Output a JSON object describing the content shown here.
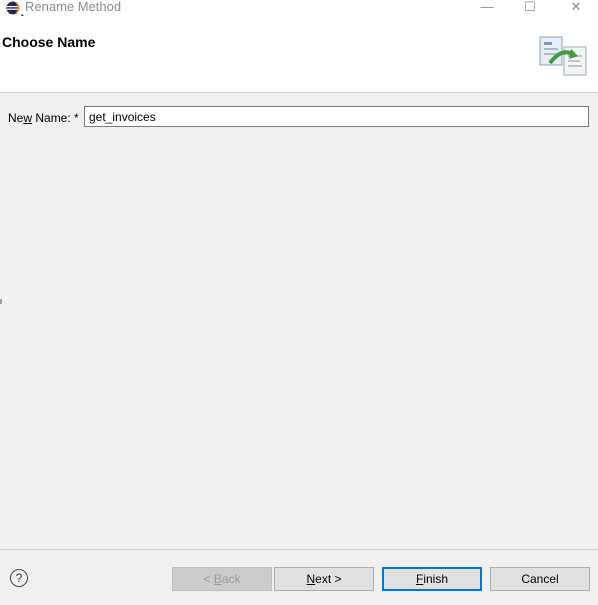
{
  "window": {
    "title": "Rename Method",
    "minimize_glyph": "—",
    "maximize_glyph": "☐",
    "close_glyph": "✕"
  },
  "banner": {
    "title": "Choose Name",
    "image_icon": "rename-refactor-icon"
  },
  "form": {
    "label_pre": "Ne",
    "label_mnemonic": "w",
    "label_post": " Name: *",
    "value": "get_invoices"
  },
  "footer": {
    "help_glyph": "?",
    "back_pre": "< ",
    "back_mnemonic": "B",
    "back_post": "ack",
    "next_mnemonic": "N",
    "next_post": "ext >",
    "finish_mnemonic": "F",
    "finish_post": "inish",
    "cancel_label": "Cancel"
  }
}
